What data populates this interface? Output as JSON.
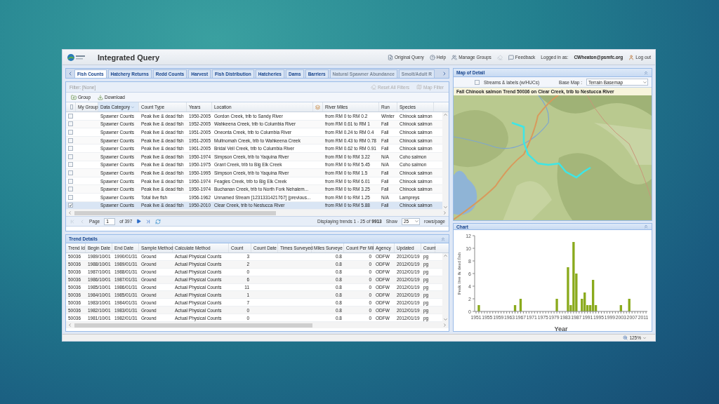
{
  "header": {
    "title": "Integrated Query",
    "links": [
      {
        "label": "Original Query"
      },
      {
        "label": "Help"
      },
      {
        "label": "Manage Groups"
      },
      {
        "label": "Feedback"
      }
    ],
    "logged_in_label": "Logged in as:",
    "user": "CWheaton@psmfc.org",
    "logout": "Log out"
  },
  "tabs": [
    {
      "label": "Fish Counts",
      "selected": true,
      "disabled": false
    },
    {
      "label": "Hatchery Returns",
      "selected": false,
      "disabled": false
    },
    {
      "label": "Redd Counts",
      "selected": false,
      "disabled": false
    },
    {
      "label": "Harvest",
      "selected": false,
      "disabled": false
    },
    {
      "label": "Fish Distribution",
      "selected": false,
      "disabled": false
    },
    {
      "label": "Hatcheries",
      "selected": false,
      "disabled": false
    },
    {
      "label": "Dams",
      "selected": false,
      "disabled": false
    },
    {
      "label": "Barriers",
      "selected": false,
      "disabled": false
    },
    {
      "label": "Natural Spawner Abundance",
      "selected": false,
      "disabled": true
    },
    {
      "label": "Smolt/Adult R",
      "selected": false,
      "disabled": true
    }
  ],
  "filter": {
    "text": "Filter: [None]",
    "reset": {
      "label": "Reset All Filters",
      "disabled": true
    },
    "map_filter": {
      "label": "Map Filter",
      "disabled": true
    }
  },
  "toolbar": [
    {
      "label": "Group"
    },
    {
      "label": "Download"
    }
  ],
  "grid": {
    "all_checked": false,
    "columns": [
      {
        "label": "My Group",
        "sorted": false
      },
      {
        "label": "Data Category",
        "sorted": true
      },
      {
        "label": "Count Type",
        "sorted": false
      },
      {
        "label": "Years",
        "sorted": false
      },
      {
        "label": "Location",
        "sorted": false
      },
      {
        "label": "River Miles",
        "sorted": false
      },
      {
        "label": "Run",
        "sorted": false
      },
      {
        "label": "Species",
        "sorted": false
      }
    ],
    "rows": [
      {
        "checked": false,
        "selected": false,
        "category": "Spawner Counts",
        "count_type": "Peak live & dead fish",
        "years": "1950-2005",
        "location": "Gordon Creek, trib to Sandy River",
        "river_miles": "from RM 0 to RM 0.2",
        "run": "Winter",
        "species": "Chinook salmon"
      },
      {
        "checked": false,
        "selected": false,
        "category": "Spawner Counts",
        "count_type": "Peak live & dead fish",
        "years": "1952-2005",
        "location": "Wahkeena Creek, trib to Columbia River",
        "river_miles": "from RM 0.61 to RM 1",
        "run": "Fall",
        "species": "Chinook salmon"
      },
      {
        "checked": false,
        "selected": false,
        "category": "Spawner Counts",
        "count_type": "Peak live & dead fish",
        "years": "1951-2005",
        "location": "Oneonta Creek, trib to Columbia River",
        "river_miles": "from RM 0.24 to RM 0.4",
        "run": "Fall",
        "species": "Chinook salmon"
      },
      {
        "checked": false,
        "selected": false,
        "category": "Spawner Counts",
        "count_type": "Peak live & dead fish",
        "years": "1951-2005",
        "location": "Multnomah Creek, trib to Wahkeena Creek",
        "river_miles": "from RM 0.43 to RM 0.78",
        "run": "Fall",
        "species": "Chinook salmon"
      },
      {
        "checked": false,
        "selected": false,
        "category": "Spawner Counts",
        "count_type": "Peak live & dead fish",
        "years": "1961-2005",
        "location": "Bridal Veil Creek, trib to Columbia River",
        "river_miles": "from RM 0.62 to RM 0.91",
        "run": "Fall",
        "species": "Chinook salmon"
      },
      {
        "checked": false,
        "selected": false,
        "category": "Spawner Counts",
        "count_type": "Peak live & dead fish",
        "years": "1950-1974",
        "location": "Simpson Creek, trib to Yaquina River",
        "river_miles": "from RM 0 to RM 3.22",
        "run": "N/A",
        "species": "Coho salmon"
      },
      {
        "checked": false,
        "selected": false,
        "category": "Spawner Counts",
        "count_type": "Peak live & dead fish",
        "years": "1950-1975",
        "location": "Grant Creek, trib to Big Elk Creek",
        "river_miles": "from RM 0 to RM 5.45",
        "run": "N/A",
        "species": "Coho salmon"
      },
      {
        "checked": false,
        "selected": false,
        "category": "Spawner Counts",
        "count_type": "Peak live & dead fish",
        "years": "1950-1995",
        "location": "Simpson Creek, trib to Yaquina River",
        "river_miles": "from RM 0 to RM 1.5",
        "run": "Fall",
        "species": "Chinook salmon"
      },
      {
        "checked": false,
        "selected": false,
        "category": "Spawner Counts",
        "count_type": "Peak live & dead fish",
        "years": "1950-1974",
        "location": "Feagles Creek, trib to Big Elk Creek",
        "river_miles": "from RM 0 to RM 6.01",
        "run": "Fall",
        "species": "Chinook salmon"
      },
      {
        "checked": false,
        "selected": false,
        "category": "Spawner Counts",
        "count_type": "Peak live & dead fish",
        "years": "1950-1974",
        "location": "Buchanan Creek, trib to North Fork Nehalem...",
        "river_miles": "from RM 0 to RM 3.25",
        "run": "Fall",
        "species": "Chinook salmon"
      },
      {
        "checked": false,
        "selected": false,
        "category": "Spawner Counts",
        "count_type": "Total live fish",
        "years": "1956-1962",
        "location": "Unnamed Stream [1231331421767] (previous...",
        "river_miles": "from RM 0 to RM 1.25",
        "run": "N/A",
        "species": "Lampreys"
      },
      {
        "checked": true,
        "selected": true,
        "category": "Spawner Counts",
        "count_type": "Peak live & dead fish",
        "years": "1950-2010",
        "location": "Clear Creek, trib to Nestucca River",
        "river_miles": "from RM 0 to RM 5.88",
        "run": "Fall",
        "species": "Chinook salmon"
      }
    ]
  },
  "pager": {
    "page_label": "Page",
    "page": "1",
    "of": "of 397",
    "summary": "Displaying trends 1 - 25 of **9913**",
    "show": "Show",
    "page_size": "25",
    "per_page": "rows/page"
  },
  "trend": {
    "title": "Trend Details",
    "columns": [
      "Trend Id",
      "Begin Date",
      "End Date",
      "Sample Method",
      "Calculate Method",
      "Count",
      "Count Date",
      "Times Surveyed",
      "Miles Surveye",
      "Count Per Mil",
      "Agency",
      "Updated",
      "Count"
    ],
    "rows": [
      {
        "id": "50036",
        "begin": "1989/10/01",
        "end": "1990/01/31",
        "sample": "Ground",
        "calc": "Actual Physical Counts",
        "count": "3",
        "miles": "0.8",
        "per_mile": "0",
        "agency": "ODFW",
        "updated": "2012/01/19",
        "unit": "pg"
      },
      {
        "id": "50036",
        "begin": "1988/10/01",
        "end": "1989/01/31",
        "sample": "Ground",
        "calc": "Actual Physical Counts",
        "count": "2",
        "miles": "0.8",
        "per_mile": "0",
        "agency": "ODFW",
        "updated": "2012/01/19",
        "unit": "pg"
      },
      {
        "id": "50036",
        "begin": "1987/10/01",
        "end": "1988/01/31",
        "sample": "Ground",
        "calc": "Actual Physical Counts",
        "count": "0",
        "miles": "0.8",
        "per_mile": "0",
        "agency": "ODFW",
        "updated": "2012/01/19",
        "unit": "pg"
      },
      {
        "id": "50036",
        "begin": "1986/10/01",
        "end": "1987/01/31",
        "sample": "Ground",
        "calc": "Actual Physical Counts",
        "count": "6",
        "miles": "0.8",
        "per_mile": "0",
        "agency": "ODFW",
        "updated": "2012/01/19",
        "unit": "pg"
      },
      {
        "id": "50036",
        "begin": "1985/10/01",
        "end": "1986/01/31",
        "sample": "Ground",
        "calc": "Actual Physical Counts",
        "count": "11",
        "miles": "0.8",
        "per_mile": "0",
        "agency": "ODFW",
        "updated": "2012/01/19",
        "unit": "pg"
      },
      {
        "id": "50036",
        "begin": "1984/10/01",
        "end": "1985/01/31",
        "sample": "Ground",
        "calc": "Actual Physical Counts",
        "count": "1",
        "miles": "0.8",
        "per_mile": "0",
        "agency": "ODFW",
        "updated": "2012/01/19",
        "unit": "pg"
      },
      {
        "id": "50036",
        "begin": "1983/10/01",
        "end": "1984/01/31",
        "sample": "Ground",
        "calc": "Actual Physical Counts",
        "count": "7",
        "miles": "0.8",
        "per_mile": "0",
        "agency": "ODFW",
        "updated": "2012/01/19",
        "unit": "pg"
      },
      {
        "id": "50036",
        "begin": "1982/10/01",
        "end": "1983/01/31",
        "sample": "Ground",
        "calc": "Actual Physical Counts",
        "count": "0",
        "miles": "0.8",
        "per_mile": "0",
        "agency": "ODFW",
        "updated": "2012/01/19",
        "unit": "pg"
      },
      {
        "id": "50036",
        "begin": "1981/10/01",
        "end": "1982/01/31",
        "sample": "Ground",
        "calc": "Actual Physical Counts",
        "count": "0",
        "miles": "0.8",
        "per_mile": "0",
        "agency": "ODFW",
        "updated": "2012/01/19",
        "unit": "pg"
      }
    ]
  },
  "map": {
    "title": "Map of Detail",
    "streams_label": "Streams & labels (w/HUCs)",
    "streams_checked": false,
    "base_map_label": "Base Map :",
    "base_map": "Terrain Basemap",
    "caption": "Fall Chinook salmon Trend 50036 on Clear Creek, trib to Nestucca River",
    "kind": "picture"
  },
  "chart_panel": {
    "title": "Chart",
    "chart_data": {
      "type": "bar",
      "xlabel": "Year",
      "ylabel": "Peak live & dead fish",
      "x": [
        1951,
        1952,
        1953,
        1954,
        1955,
        1956,
        1957,
        1958,
        1959,
        1960,
        1961,
        1962,
        1963,
        1964,
        1965,
        1966,
        1967,
        1968,
        1969,
        1970,
        1971,
        1972,
        1973,
        1974,
        1975,
        1976,
        1977,
        1978,
        1979,
        1980,
        1981,
        1982,
        1983,
        1984,
        1985,
        1986,
        1987,
        1988,
        1989,
        1990,
        1991,
        1992,
        1993,
        1994,
        1995,
        1996,
        1997,
        1998,
        1999,
        2000,
        2001,
        2002,
        2003,
        2004,
        2005,
        2006,
        2007,
        2008,
        2009,
        2010,
        2011,
        2012
      ],
      "series": [
        {
          "color": "#8aaa1c",
          "values": [
            0,
            1,
            0,
            0,
            0,
            0,
            0,
            0,
            0,
            0,
            0,
            0,
            0,
            0,
            1,
            0,
            2,
            0,
            0,
            0,
            0,
            0,
            0,
            0,
            0,
            0,
            0,
            0,
            0,
            2,
            0,
            0,
            0,
            7,
            1,
            11,
            6,
            0,
            2,
            3,
            1,
            1,
            5,
            1,
            0,
            0,
            0,
            0,
            0,
            0,
            0,
            0,
            1,
            0,
            0,
            2,
            0,
            0,
            0,
            0,
            0,
            0
          ]
        }
      ],
      "xlim": [
        1950.5,
        2012.5
      ],
      "ylim": [
        0,
        12
      ],
      "yticks": [
        0,
        2,
        4,
        6,
        8,
        10,
        12
      ],
      "xticks": [
        1951,
        1955,
        1959,
        1963,
        1967,
        1971,
        1975,
        1979,
        1983,
        1987,
        1991,
        1995,
        1999,
        2003,
        2007,
        2011
      ]
    }
  },
  "status_bar": {
    "zoom": "125%"
  }
}
